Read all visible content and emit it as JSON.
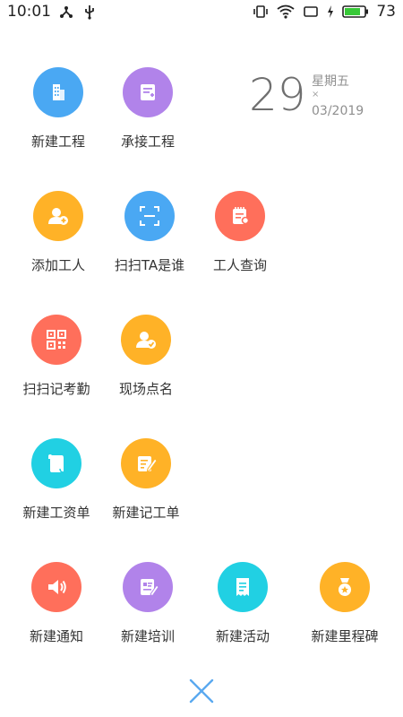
{
  "status_bar": {
    "time": "10:01",
    "battery": "73"
  },
  "date": {
    "day": "29",
    "weekday": "星期五",
    "separator": "×",
    "month_year": "03/2019"
  },
  "colors": {
    "blue": "#4aa8f3",
    "purple": "#b183ea",
    "orange": "#ffb227",
    "coral": "#ff6f5b",
    "cyan": "#21d0e3",
    "close": "#5aa9f0"
  },
  "items": [
    {
      "label": "新建工程",
      "icon": "building-icon",
      "color": "#4aa8f3"
    },
    {
      "label": "承接工程",
      "icon": "document-add-icon",
      "color": "#b183ea"
    },
    {
      "label": "添加工人",
      "icon": "user-add-icon",
      "color": "#ffb227"
    },
    {
      "label": "扫扫TA是谁",
      "icon": "scan-icon",
      "color": "#4aa8f3"
    },
    {
      "label": "工人查询",
      "icon": "notebook-search-icon",
      "color": "#ff6f5b"
    },
    {
      "label": "扫扫记考勤",
      "icon": "qr-code-icon",
      "color": "#ff6f5b"
    },
    {
      "label": "现场点名",
      "icon": "user-check-icon",
      "color": "#ffb227"
    },
    {
      "label": "新建工资单",
      "icon": "scroll-icon",
      "color": "#21d0e3"
    },
    {
      "label": "新建记工单",
      "icon": "edit-note-icon",
      "color": "#ffb227"
    },
    {
      "label": "新建通知",
      "icon": "speaker-icon",
      "color": "#ff6f5b"
    },
    {
      "label": "新建培训",
      "icon": "training-icon",
      "color": "#b183ea"
    },
    {
      "label": "新建活动",
      "icon": "receipt-icon",
      "color": "#21d0e3"
    },
    {
      "label": "新建里程碑",
      "icon": "medal-icon",
      "color": "#ffb227"
    }
  ]
}
